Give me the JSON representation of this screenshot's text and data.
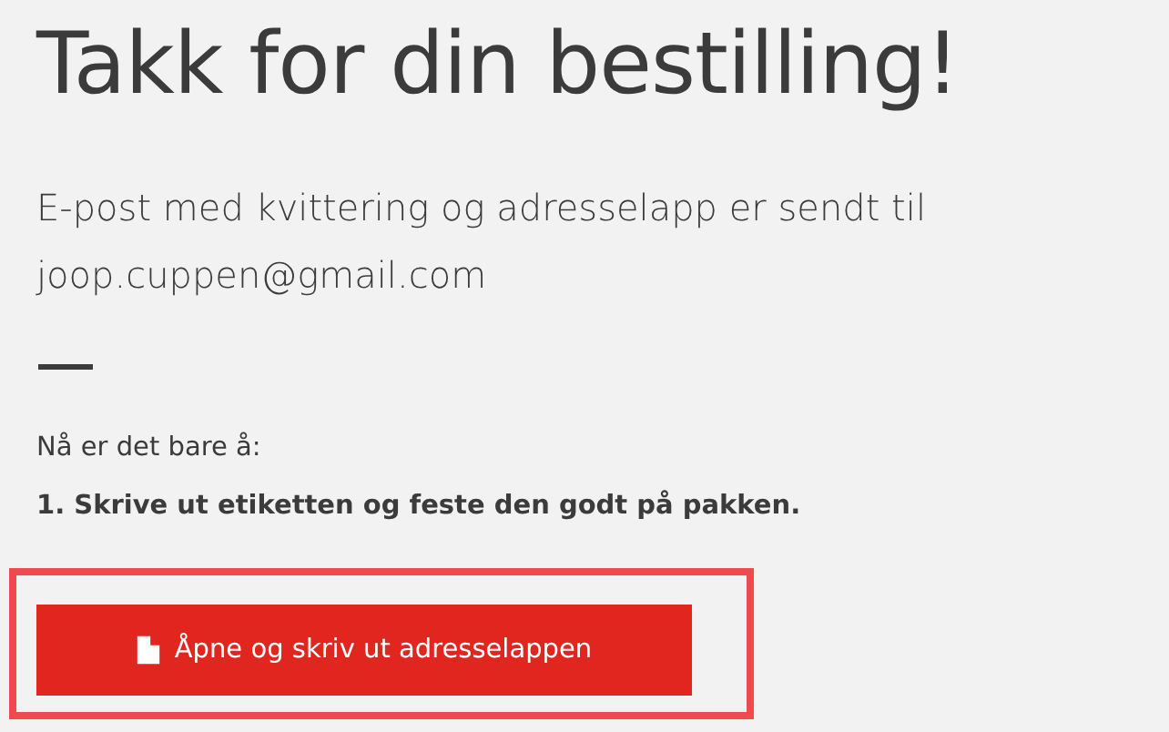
{
  "title": "Takk for din bestilling!",
  "message": {
    "text": "E-post med kvittering og adresselapp er sendt til",
    "email": "joop.cuppen@gmail.com"
  },
  "instructions": {
    "intro": "Nå er det bare å:",
    "steps": [
      "1. Skrive ut etiketten og feste den godt på pakken."
    ]
  },
  "print_button": {
    "label": "Åpne og skriv ut adresselappen"
  }
}
